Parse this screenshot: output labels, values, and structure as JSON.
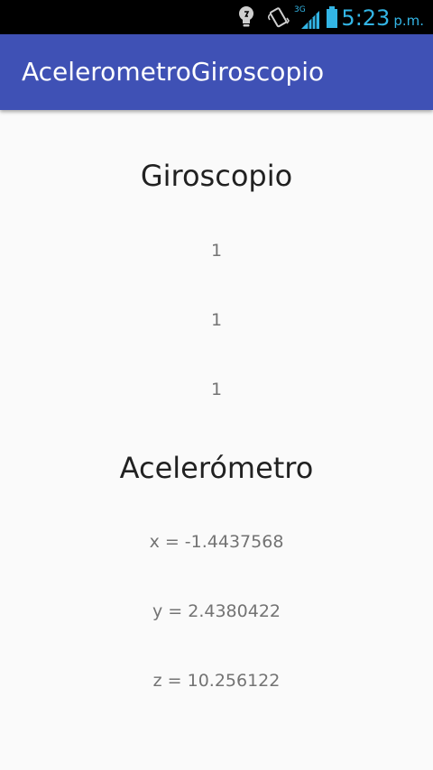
{
  "status_bar": {
    "time": "5:23",
    "ampm": "p.m.",
    "network_label": "3G",
    "icons": [
      "lightbulb-icon",
      "vibrate-icon",
      "signal-icon",
      "battery-icon"
    ],
    "accent_color": "#33b5e5"
  },
  "app_bar": {
    "title": "AcelerometroGiroscopio",
    "color": "#3f51b5"
  },
  "gyroscope": {
    "heading": "Giroscopio",
    "values": [
      "1",
      "1",
      "1"
    ]
  },
  "accelerometer": {
    "heading": "Acelerómetro",
    "x": "x = -1.4437568",
    "y": "y = 2.4380422",
    "z": "z = 10.256122"
  }
}
